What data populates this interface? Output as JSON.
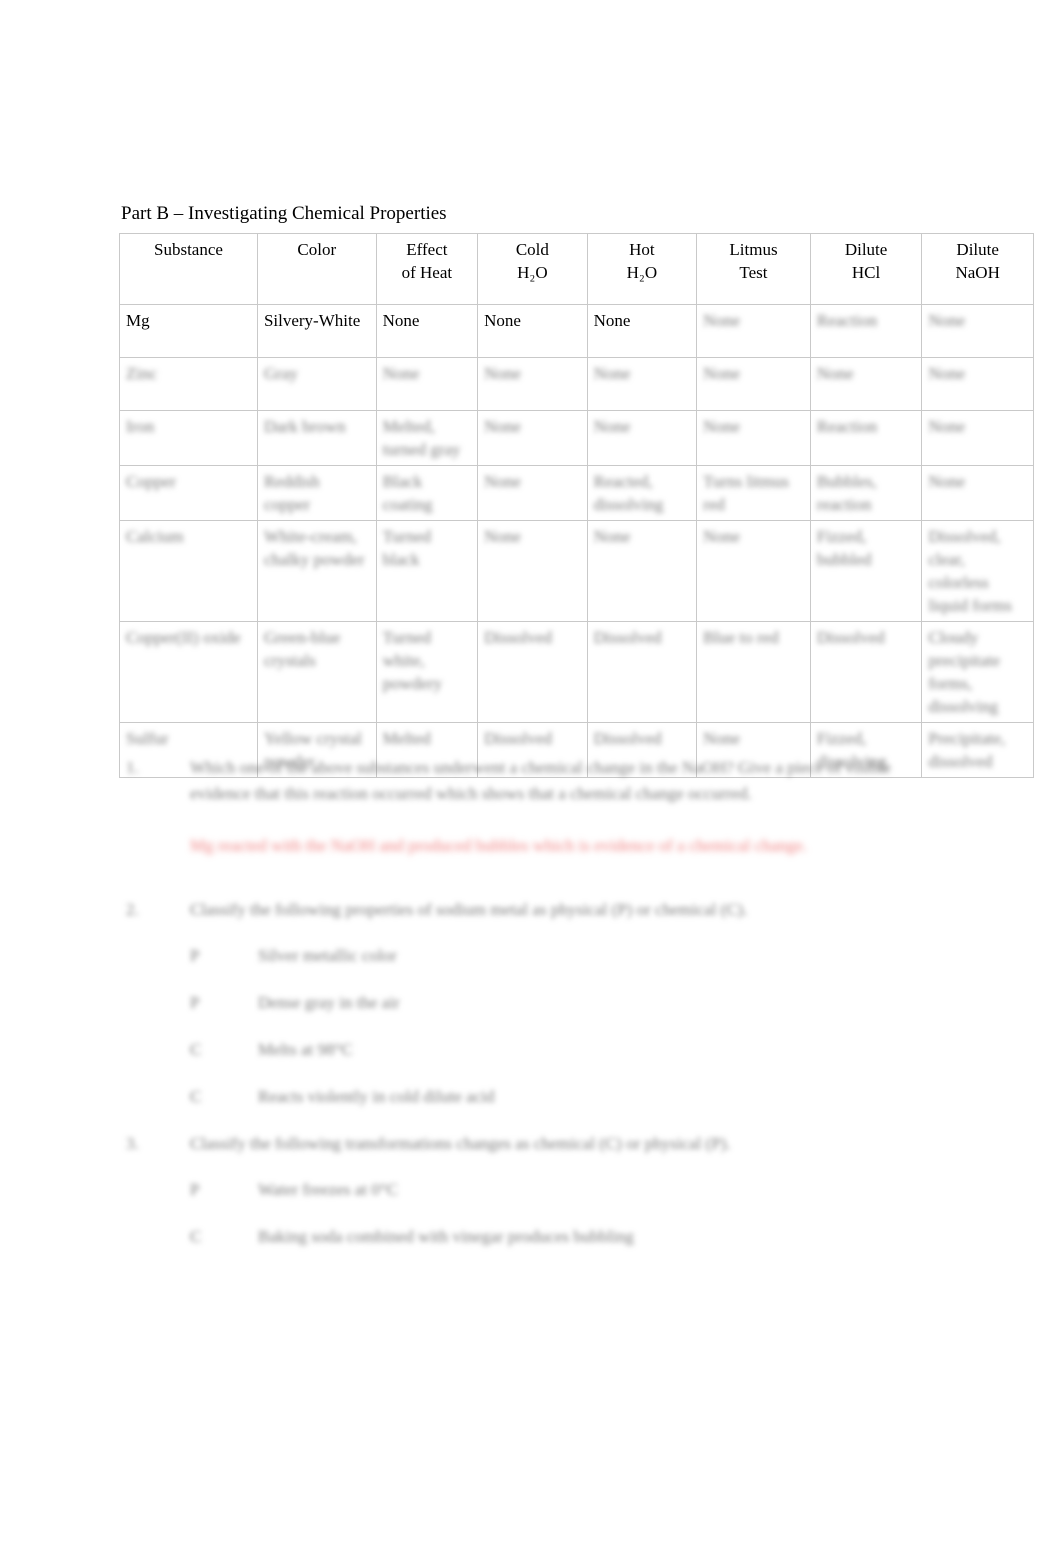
{
  "page": {
    "title": "Part B – Investigating Chemical Properties"
  },
  "table": {
    "headers": [
      {
        "line1": "Substance",
        "line2": ""
      },
      {
        "line1": "Color",
        "line2": ""
      },
      {
        "line1": "Effect",
        "line2": "of Heat"
      },
      {
        "line1": "Cold",
        "line2": "H₂O"
      },
      {
        "line1": "Hot",
        "line2": "H₂O"
      },
      {
        "line1": "Litmus",
        "line2": "Test"
      },
      {
        "line1": "Dilute",
        "line2": "HCl"
      },
      {
        "line1": "Dilute",
        "line2": "NaOH"
      }
    ],
    "rows": [
      {
        "substance": "Mg",
        "color": "Silvery-White",
        "heat": "None",
        "cold": "None",
        "hot": "None",
        "litmus": "None",
        "hcl": "Reaction",
        "naoh": "None"
      },
      {
        "substance": "Zinc",
        "color": "Gray",
        "heat": "None",
        "cold": "None",
        "hot": "None",
        "litmus": "None",
        "hcl": "None",
        "naoh": "None"
      },
      {
        "substance": "Iron",
        "color": "Dark brown",
        "heat": "Melted, turned gray",
        "cold": "None",
        "hot": "None",
        "litmus": "None",
        "hcl": "Reaction",
        "naoh": "None"
      },
      {
        "substance": "Copper",
        "color": "Reddish copper",
        "heat": "Black coating",
        "cold": "None",
        "hot": "Reacted, dissolving",
        "litmus": "Turns litmus red",
        "hcl": "Bubbles, reaction",
        "naoh": "None"
      },
      {
        "substance": "Calcium",
        "color": "White-cream, chalky powder",
        "heat": "Turned black",
        "cold": "None",
        "hot": "None",
        "litmus": "None",
        "hcl": "Fizzed, bubbled",
        "naoh": "Dissolved, clear, colorless liquid forms"
      },
      {
        "substance": "Copper(II) oxide",
        "color": "Green-blue crystals",
        "heat": "Turned white, powdery",
        "cold": "Dissolved",
        "hot": "Dissolved",
        "litmus": "Blue to red",
        "hcl": "Dissolved",
        "naoh": "Cloudy precipitate forms, dissolving"
      },
      {
        "substance": "Sulfur",
        "color": "Yellow crystal powder",
        "heat": "Melted",
        "cold": "Dissolved",
        "hot": "Dissolved",
        "litmus": "None",
        "hcl": "Fizzed, dissolving",
        "naoh": "Precipitate, dissolved"
      }
    ]
  },
  "questions": [
    {
      "number": "1.",
      "text": "Which one of the above substances underwent a chemical change in the NaOH? Give a piece of visible evidence that this reaction occurred which shows that a chemical change occurred.",
      "answer": "Mg reacted with the NaOH and produced bubbles which is evidence of a chemical change.",
      "subitems": []
    },
    {
      "number": "2.",
      "text": "Classify the following properties of sodium metal as physical (P) or chemical (C).",
      "answer": "",
      "subitems": [
        {
          "label": "P",
          "text": "Silver metallic color"
        },
        {
          "label": "P",
          "text": "Dense gray in the air"
        },
        {
          "label": "C",
          "text": "Melts at 98°C"
        },
        {
          "label": "C",
          "text": "Reacts violently in cold dilute acid"
        }
      ]
    },
    {
      "number": "3.",
      "text": "Classify the following transformations changes as chemical (C) or physical (P).",
      "answer": "",
      "subitems": [
        {
          "label": "P",
          "text": "Water freezes at 0°C"
        },
        {
          "label": "C",
          "text": "Baking soda combined with vinegar produces bubbling"
        }
      ]
    }
  ]
}
